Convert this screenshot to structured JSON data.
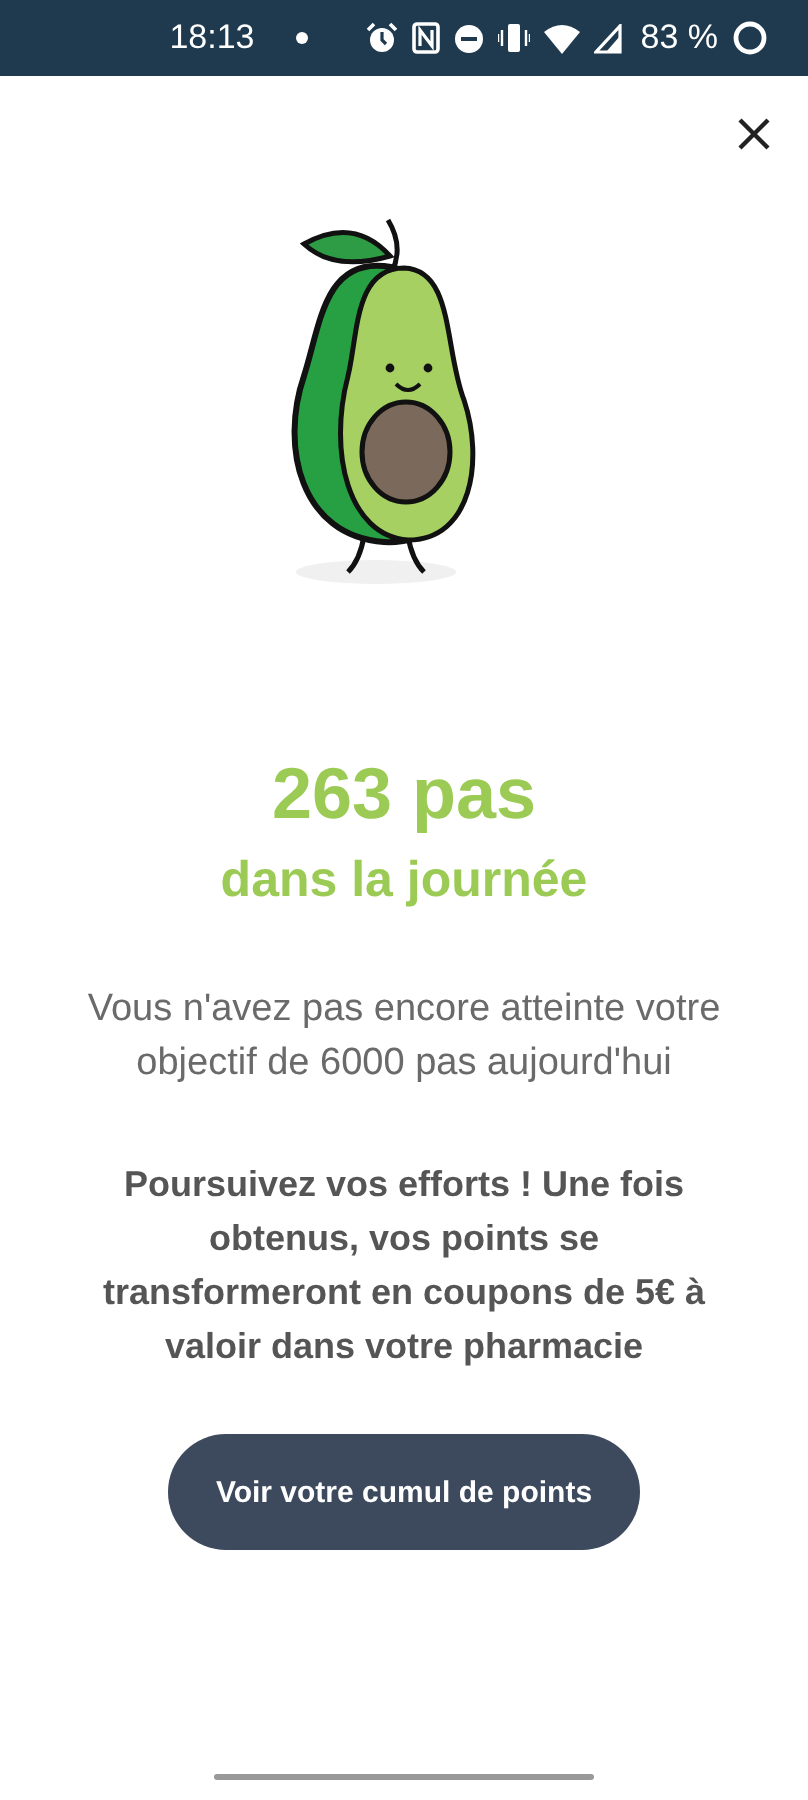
{
  "status_bar": {
    "time": "18:13",
    "battery": "83 %"
  },
  "steps": {
    "count": "263 pas",
    "subtitle": "dans la journée"
  },
  "message": "Vous n'avez pas encore atteinte votre objectif de 6000 pas aujourd'hui",
  "encouragement": "Poursuivez vos efforts ! Une fois obtenus, vos points se transformeront en coupons de 5€ à valoir dans votre pharmacie",
  "button": "Voir votre cumul de points"
}
